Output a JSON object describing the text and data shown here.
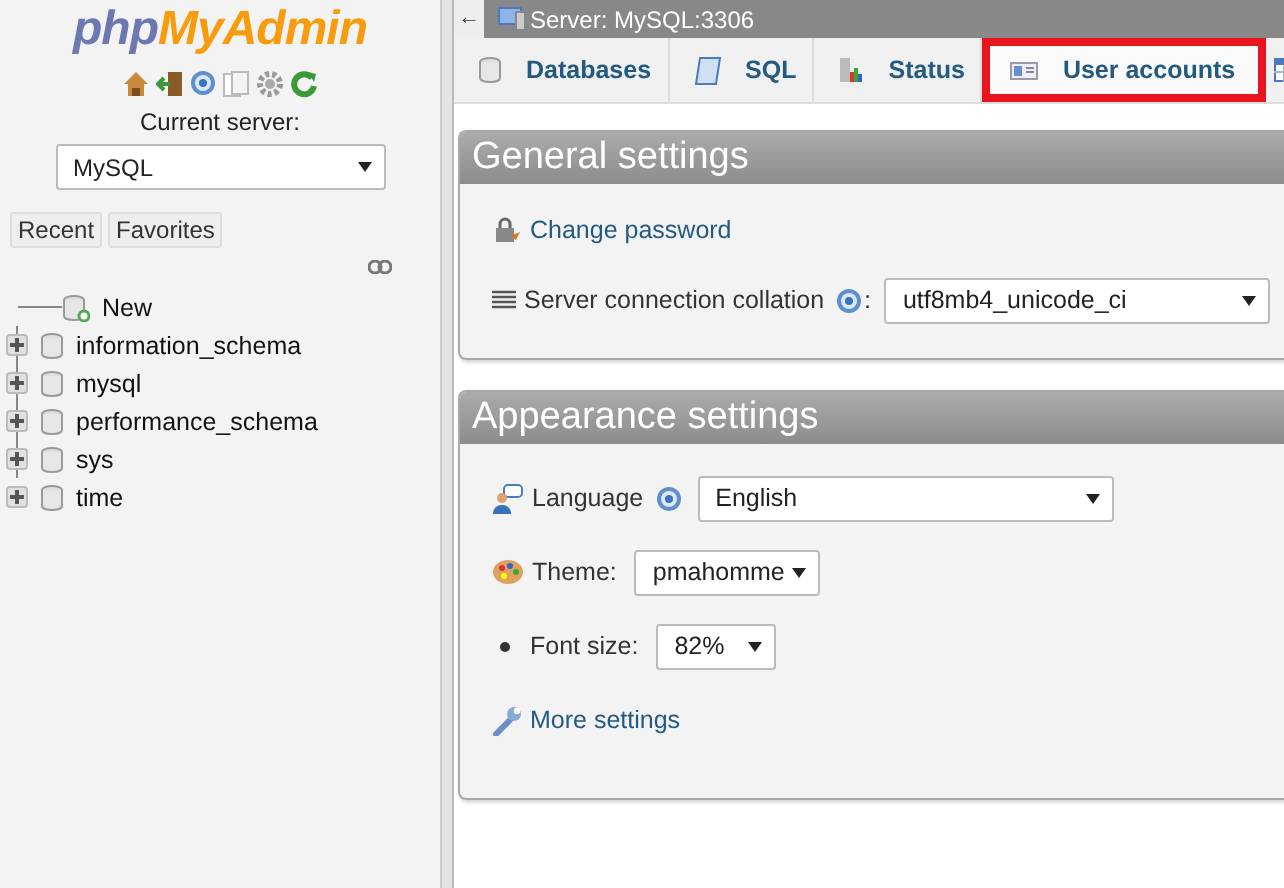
{
  "sidebar": {
    "logo": {
      "prefix": "php",
      "name": "MyAdmin"
    },
    "server_label": "Current server:",
    "server_select": {
      "value": "MySQL"
    },
    "buttons": [
      "Recent",
      "Favorites"
    ],
    "tree": [
      {
        "label": "New",
        "kind": "new"
      },
      {
        "label": "information_schema",
        "kind": "database",
        "expanded": false
      },
      {
        "label": "mysql",
        "kind": "database",
        "expanded": false
      },
      {
        "label": "performance_schema",
        "kind": "database",
        "expanded": false
      },
      {
        "label": "sys",
        "kind": "database",
        "expanded": false
      },
      {
        "label": "time",
        "kind": "database",
        "expanded": false
      }
    ]
  },
  "breadcrumb": {
    "back": "←",
    "label": "Server: MySQL:3306"
  },
  "tabs": [
    {
      "label": "Databases",
      "kind": "databases",
      "highlighted": false
    },
    {
      "label": "SQL",
      "kind": "sql",
      "highlighted": false
    },
    {
      "label": "Status",
      "kind": "status",
      "highlighted": false
    },
    {
      "label": "User accounts",
      "kind": "users",
      "highlighted": true
    },
    {
      "kind": "export",
      "highlighted": false
    }
  ],
  "sections": [
    {
      "title": "General settings",
      "items": [
        {
          "kind": "link",
          "label": "Change password"
        },
        {
          "kind": "select",
          "label": "Server connection collation",
          "help": true,
          "colon": ":",
          "value": "utf8mb4_unicode_ci"
        }
      ]
    },
    {
      "title": "Appearance settings",
      "items": [
        {
          "kind": "select",
          "label": "Language",
          "help": true,
          "value": "English"
        },
        {
          "kind": "select",
          "label": "Theme:",
          "value": "pmahomme"
        },
        {
          "kind": "bullet-select",
          "label": "Font size:",
          "value": "82%"
        },
        {
          "kind": "link",
          "label": "More settings"
        }
      ]
    }
  ]
}
